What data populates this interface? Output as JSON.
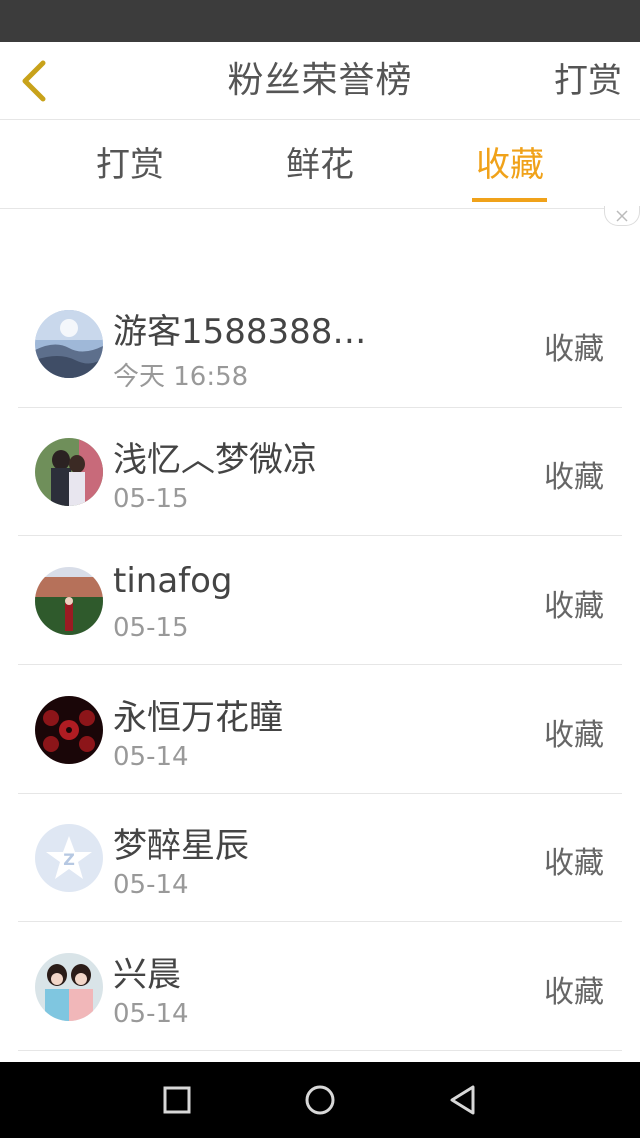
{
  "header": {
    "title": "粉丝荣誉榜",
    "right_action": "打赏"
  },
  "tabs": [
    {
      "label": "打赏",
      "active": false
    },
    {
      "label": "鲜花",
      "active": false
    },
    {
      "label": "收藏",
      "active": true
    }
  ],
  "colors": {
    "accent": "#f0a21a",
    "divider": "#e6e6e6",
    "text": "#444444",
    "subtext": "#999999"
  },
  "list": [
    {
      "name": "游客1588388…",
      "time": "今天 16:58",
      "action": "收藏"
    },
    {
      "name": "浅忆︿梦微凉",
      "time": "05-15",
      "action": "收藏"
    },
    {
      "name": "tinafog",
      "time": "05-15",
      "action": "收藏"
    },
    {
      "name": "永恒万花瞳",
      "time": "05-14",
      "action": "收藏"
    },
    {
      "name": "梦醉星辰",
      "time": "05-14",
      "action": "收藏"
    },
    {
      "name": "兴晨",
      "time": "05-14",
      "action": "收藏"
    }
  ]
}
